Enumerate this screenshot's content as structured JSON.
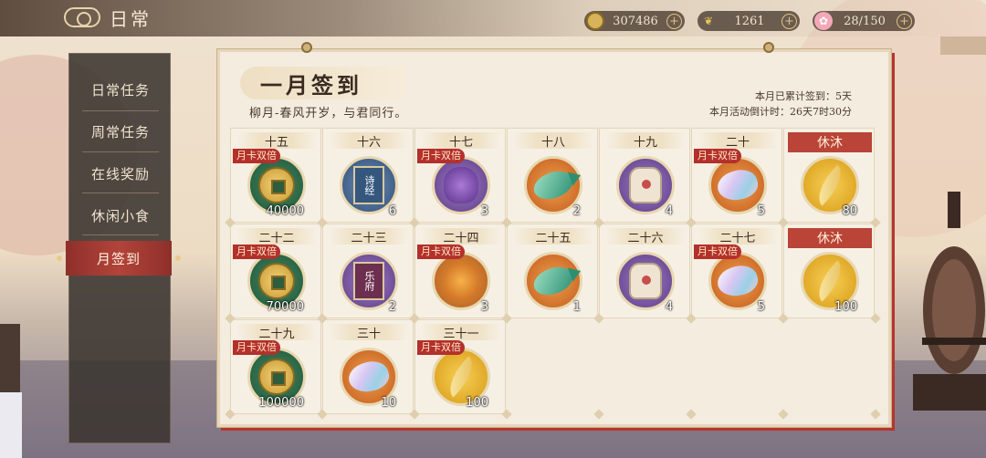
{
  "header": {
    "title": "日常",
    "icon": "cloud-scroll-icon"
  },
  "resources": [
    {
      "name": "coins",
      "icon": "coin-icon",
      "value": "307486"
    },
    {
      "name": "feathers",
      "icon": "feather-icon",
      "value": "1261"
    },
    {
      "name": "flowers",
      "icon": "flower-icon",
      "value": "28/150"
    }
  ],
  "sidebar": {
    "items": [
      {
        "label": "日常任务",
        "active": false
      },
      {
        "label": "周常任务",
        "active": false
      },
      {
        "label": "在线奖励",
        "active": false
      },
      {
        "label": "休闲小食",
        "active": false
      },
      {
        "label": "月签到",
        "active": true
      }
    ]
  },
  "panel": {
    "title": "一月签到",
    "subtitle": "柳月-春风开岁，与君同行。",
    "cumulative": "本月已累计签到：5天",
    "countdown": "本月活动倒计时：26天7时30分"
  },
  "double_label": "月卡双倍",
  "days": [
    {
      "day": "十五",
      "double": true,
      "rest": false,
      "item": "coin",
      "icon": "copper-coin-icon",
      "qty": "40000"
    },
    {
      "day": "十六",
      "double": false,
      "rest": false,
      "item": "book-blue",
      "icon": "book-icon",
      "book_title": "诗经",
      "qty": "6"
    },
    {
      "day": "十七",
      "double": true,
      "rest": false,
      "item": "pouch-purple",
      "icon": "pouch-icon",
      "qty": "3"
    },
    {
      "day": "十八",
      "double": false,
      "rest": false,
      "item": "fish",
      "icon": "jade-fish-icon",
      "qty": "2"
    },
    {
      "day": "十九",
      "double": false,
      "rest": false,
      "item": "sachet",
      "icon": "sachet-icon",
      "qty": "4"
    },
    {
      "day": "二十",
      "double": true,
      "rest": false,
      "item": "shell",
      "icon": "shell-icon",
      "qty": "5"
    },
    {
      "day": "休沐",
      "double": false,
      "rest": true,
      "item": "feather",
      "icon": "feather-icon",
      "qty": "80"
    },
    {
      "day": "二十二",
      "double": true,
      "rest": false,
      "item": "coin",
      "icon": "copper-coin-icon",
      "qty": "70000"
    },
    {
      "day": "二十三",
      "double": false,
      "rest": false,
      "item": "book-red",
      "icon": "book-icon",
      "book_title": "乐府",
      "qty": "2"
    },
    {
      "day": "二十四",
      "double": true,
      "rest": false,
      "item": "pouch-orange",
      "icon": "pouch-icon",
      "qty": "3"
    },
    {
      "day": "二十五",
      "double": false,
      "rest": false,
      "item": "fish",
      "icon": "jade-fish-icon",
      "qty": "1"
    },
    {
      "day": "二十六",
      "double": false,
      "rest": false,
      "item": "sachet",
      "icon": "sachet-icon",
      "qty": "4"
    },
    {
      "day": "二十七",
      "double": true,
      "rest": false,
      "item": "shell",
      "icon": "shell-icon",
      "qty": "5"
    },
    {
      "day": "休沐",
      "double": false,
      "rest": true,
      "item": "feather",
      "icon": "feather-icon",
      "qty": "100"
    },
    {
      "day": "二十九",
      "double": true,
      "rest": false,
      "item": "coin",
      "icon": "copper-coin-icon",
      "qty": "100000"
    },
    {
      "day": "三十",
      "double": false,
      "rest": false,
      "item": "shell",
      "icon": "shell-icon",
      "qty": "10"
    },
    {
      "day": "三十一",
      "double": true,
      "rest": false,
      "item": "feather",
      "icon": "feather-icon",
      "qty": "100"
    }
  ]
}
